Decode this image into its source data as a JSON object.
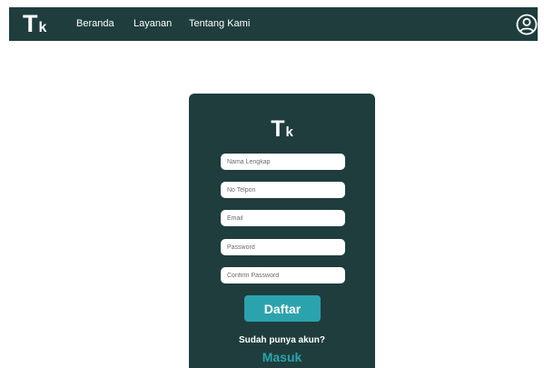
{
  "navbar": {
    "brand_big": "T",
    "brand_small": "k",
    "links": [
      "Beranda",
      "Layanan",
      "Tentang Kami"
    ],
    "profile_icon": "user-circle-icon"
  },
  "register": {
    "logo_big": "T",
    "logo_small": "k",
    "fields": [
      {
        "placeholder": "Nama Lengkap",
        "value": ""
      },
      {
        "placeholder": "No Telpon",
        "value": ""
      },
      {
        "placeholder": "Email",
        "value": ""
      },
      {
        "placeholder": "Password",
        "value": ""
      },
      {
        "placeholder": "Confirm Password",
        "value": ""
      }
    ],
    "submit_label": "Daftar",
    "prompt_text": "Sudah punya akun?",
    "login_label": "Masuk"
  },
  "colors": {
    "primary_dark": "#1f3d3d",
    "accent": "#2ba3ad",
    "white": "#ffffff"
  }
}
